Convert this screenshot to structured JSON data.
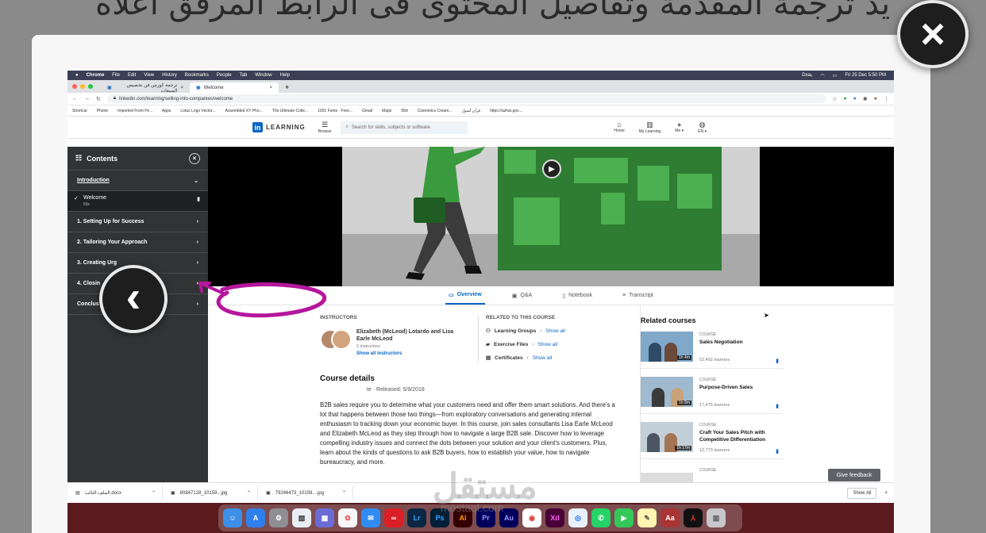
{
  "background_caption": "يد ترجمة المقدمة وتفاصيل المحتوى فى الرابط المرفق اعلاه",
  "viewer": {
    "close_glyph": "×",
    "back_glyph": "‹"
  },
  "mac_menu": {
    "apple": "",
    "app": "Chrome",
    "items": [
      "File",
      "Edit",
      "View",
      "History",
      "Bookmarks",
      "People",
      "Tab",
      "Window",
      "Help"
    ],
    "status_right": [
      "Dxa₅",
      "Fri 25 Dec  5:50 PM"
    ]
  },
  "browser": {
    "tabs": [
      {
        "title": "ترجمة كورس فن تخصيص المبيعات"
      },
      {
        "title": "Welcome"
      }
    ],
    "new_tab": "+",
    "url": "linkedin.com/learning/selling-into-companies/welcome",
    "bookmarks": [
      "Shortcut",
      "Phone",
      "Imported From Fir...",
      "Apps",
      "Lotus Logo Vector...",
      "Assembled XY Pho...",
      "The Ultimate Colle...",
      "1001 Fonts · Free...",
      "Gmail",
      "Maps",
      "99d",
      "Cosmetics Cream...",
      "قرآن أصول",
      "https://azhar.gov...."
    ]
  },
  "linkedin": {
    "logo_in": "in",
    "logo_word": "LEARNING",
    "browse": "Browse",
    "search_placeholder": "Search for skills, subjects or software",
    "nav": [
      "Home",
      "My Learning",
      "Me ▾",
      "EN ▾"
    ]
  },
  "sidebar": {
    "title": "Contents",
    "intro": "Introduction",
    "welcome": {
      "label": "Welcome",
      "duration": "59s"
    },
    "chapters": [
      "1. Setting Up for Success",
      "2. Tailoring Your Approach",
      "3. Creating Urg",
      "4. Closin",
      "Conclus"
    ]
  },
  "tabs": [
    "Overview",
    "Q&A",
    "Notebook",
    "Transcript"
  ],
  "instructors": {
    "label": "INSTRUCTORS",
    "names": "Elizabeth (McLeod) Lotardo and Lisa Earle McLeod",
    "count": "2 instructors",
    "link": "Show all instructors"
  },
  "related_this": {
    "label": "RELATED TO THIS COURSE",
    "items": [
      {
        "name": "Learning Groups",
        "link": "Show all"
      },
      {
        "name": "Exercise Files",
        "link": "Show all"
      },
      {
        "name": "Certificates",
        "link": "Show all"
      }
    ]
  },
  "course_details": {
    "title": "Course details",
    "released": "te  ·  Released: 5/9/2018",
    "description": "B2B sales require you to determine what your customers need and offer them smart solutions. And there's a lot that happens between those two things—from exploratory conversations and generating internal enthusiasm to tracking down your economic buyer. In this course, join sales consultants Lisa Earle McLeod and Elizabeth McLeod as they step through how to navigate a large B2B sale. Discover how to leverage compelling industry issues and connect the dots between your solution and your client's customers. Plus, learn about the kinds of questions to ask B2B buyers, how to establish your value, how to navigate bureaucracy, and more."
  },
  "related_courses": {
    "title": "Related courses",
    "items": [
      {
        "kind": "COURSE",
        "name": "Sales Negotiation",
        "learners": "52,452 learners",
        "duration": "1h 4m"
      },
      {
        "kind": "COURSE",
        "name": "Purpose-Driven Sales",
        "learners": "17,475 learners",
        "duration": "1h 8m"
      },
      {
        "kind": "COURSE",
        "name": "Craft Your Sales Pitch with Competitive Differentiation",
        "learners": "12,773 learners",
        "duration": "1h 17m"
      },
      {
        "kind": "COURSE"
      }
    ]
  },
  "feedback": "Give feedback",
  "downloads": {
    "files": [
      "الملف-الثالث.docx",
      "80847128_10159...jpg",
      "79246473_10159....jpg"
    ],
    "show_all": "Show All",
    "close": "×"
  },
  "dock": [
    "Finder",
    "App Store",
    "Settings",
    "Preview",
    "Launchpad",
    "Photos",
    "Mail",
    "Creative Cloud",
    "Lr",
    "Ps",
    "Ai",
    "Pr",
    "Au",
    "Chrome",
    "Xd",
    "Safari",
    "WhatsApp",
    "FaceTime",
    "Notes",
    "Dictionary",
    "Acrobat",
    "Trash"
  ],
  "watermark": "مستقل",
  "watermark_sub": "mostaql.com",
  "colors": {
    "accent": "#0a66c2",
    "annotation": "#b5169c",
    "sidebar": "#313335"
  }
}
